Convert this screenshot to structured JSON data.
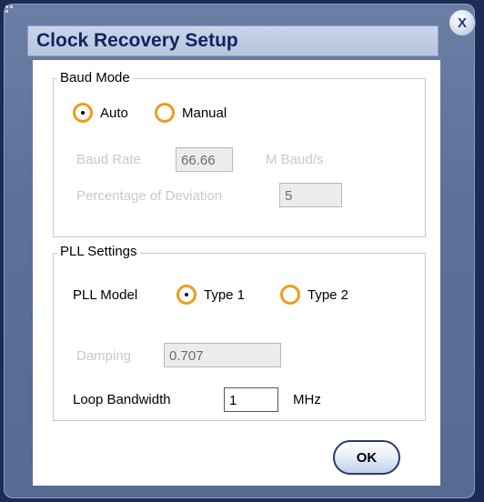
{
  "dialog": {
    "title": "Clock Recovery Setup",
    "close_label": "X"
  },
  "baud_mode": {
    "legend": "Baud Mode",
    "options": [
      {
        "label": "Auto",
        "selected": true
      },
      {
        "label": "Manual",
        "selected": false
      }
    ],
    "baud_rate": {
      "label": "Baud Rate",
      "value": "66.66",
      "unit": "M Baud/s"
    },
    "deviation": {
      "label": "Percentage of Deviation",
      "value": "5"
    }
  },
  "pll": {
    "legend": "PLL Settings",
    "model_label": "PLL Model",
    "options": [
      {
        "label": "Type 1",
        "selected": true
      },
      {
        "label": "Type 2",
        "selected": false
      }
    ],
    "damping": {
      "label": "Damping",
      "value": "0.707"
    },
    "loop_bandwidth": {
      "label": "Loop Bandwidth",
      "value": "1",
      "unit": "MHz"
    }
  },
  "buttons": {
    "ok_label": "OK"
  },
  "colors": {
    "radio_ring": "#f19a1c",
    "title": "#0d2660",
    "frame": "#5d7099"
  }
}
